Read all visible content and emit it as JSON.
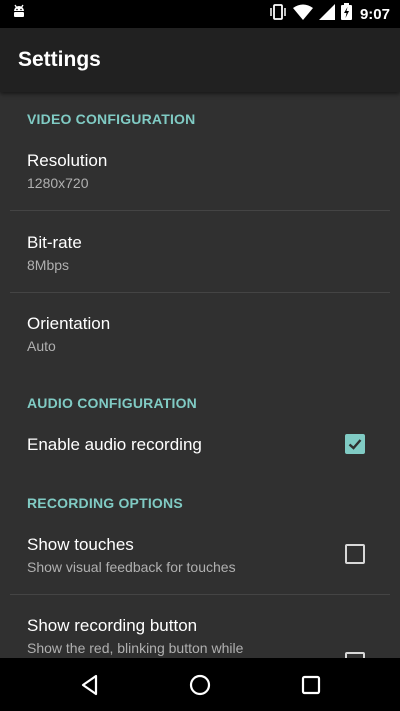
{
  "status_bar": {
    "time": "9:07",
    "icons": [
      "android-debug-icon",
      "vibrate-icon",
      "wifi-icon",
      "cell-signal-icon",
      "battery-charging-icon"
    ]
  },
  "app_bar": {
    "title": "Settings"
  },
  "colors": {
    "accent": "#80cbc4",
    "background": "#303030",
    "app_bar": "#212121"
  },
  "sections": {
    "video": {
      "header": "VIDEO CONFIGURATION",
      "resolution": {
        "title": "Resolution",
        "summary": "1280x720"
      },
      "bitrate": {
        "title": "Bit-rate",
        "summary": "8Mbps"
      },
      "orientation": {
        "title": "Orientation",
        "summary": "Auto"
      }
    },
    "audio": {
      "header": "AUDIO CONFIGURATION",
      "enable_audio": {
        "title": "Enable audio recording",
        "checked": true
      }
    },
    "recording": {
      "header": "RECORDING OPTIONS",
      "show_touches": {
        "title": "Show touches",
        "summary": "Show visual feedback for touches",
        "checked": false
      },
      "show_button": {
        "title": "Show recording button",
        "summary": "Show the red, blinking button while",
        "checked": false
      }
    }
  },
  "nav_bar": {
    "buttons": [
      "back-icon",
      "home-icon",
      "recents-icon"
    ]
  }
}
